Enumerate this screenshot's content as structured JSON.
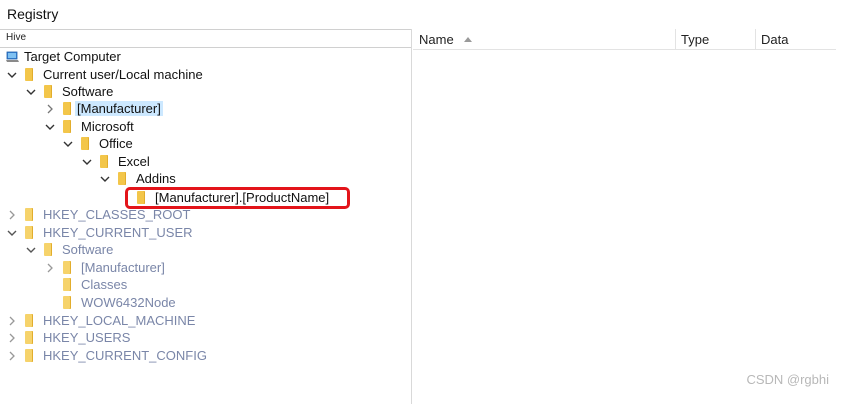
{
  "window": {
    "title": "Registry"
  },
  "left_pane": {
    "hive_header": "Hive"
  },
  "right_pane": {
    "columns": [
      {
        "label": "Name",
        "sorted": "ascending"
      },
      {
        "label": "Type"
      },
      {
        "label": "Data"
      }
    ]
  },
  "tree": {
    "nodes": [
      {
        "label": "Target Computer",
        "icon": "computer-icon",
        "expander": "none"
      },
      {
        "label": "Current user/Local machine",
        "icon": "folder-icon",
        "expander": "expanded"
      },
      {
        "label": "Software",
        "icon": "folder-icon",
        "expander": "expanded"
      },
      {
        "label": "[Manufacturer]",
        "icon": "folder-icon",
        "expander": "collapsed",
        "selected": true
      },
      {
        "label": "Microsoft",
        "icon": "folder-icon",
        "expander": "expanded"
      },
      {
        "label": "Office",
        "icon": "folder-icon",
        "expander": "expanded"
      },
      {
        "label": "Excel",
        "icon": "folder-icon",
        "expander": "expanded"
      },
      {
        "label": "Addins",
        "icon": "folder-icon",
        "expander": "expanded"
      },
      {
        "label": "[Manufacturer].[ProductName]",
        "icon": "folder-icon",
        "expander": "none",
        "highlighted": true
      },
      {
        "label": "HKEY_CLASSES_ROOT",
        "icon": "folder-icon",
        "expander": "collapsed",
        "dim": true
      },
      {
        "label": "HKEY_CURRENT_USER",
        "icon": "folder-icon",
        "expander": "expanded",
        "dim": true
      },
      {
        "label": "Software",
        "icon": "folder-icon",
        "expander": "expanded",
        "dim": true
      },
      {
        "label": "[Manufacturer]",
        "icon": "folder-icon",
        "expander": "collapsed",
        "dim": true
      },
      {
        "label": "Classes",
        "icon": "folder-icon",
        "expander": "none",
        "dim": true
      },
      {
        "label": "WOW6432Node",
        "icon": "folder-icon",
        "expander": "none",
        "dim": true
      },
      {
        "label": "HKEY_LOCAL_MACHINE",
        "icon": "folder-icon",
        "expander": "collapsed",
        "dim": true
      },
      {
        "label": "HKEY_USERS",
        "icon": "folder-icon",
        "expander": "collapsed",
        "dim": true
      },
      {
        "label": "HKEY_CURRENT_CONFIG",
        "icon": "folder-icon",
        "expander": "collapsed",
        "dim": true
      }
    ]
  },
  "watermark": "CSDN @rgbhi",
  "colors": {
    "selection": "#cce8ff",
    "highlight_border": "#e3141a",
    "folder": "#f3c64a",
    "dim_text": "#7a86a8"
  }
}
